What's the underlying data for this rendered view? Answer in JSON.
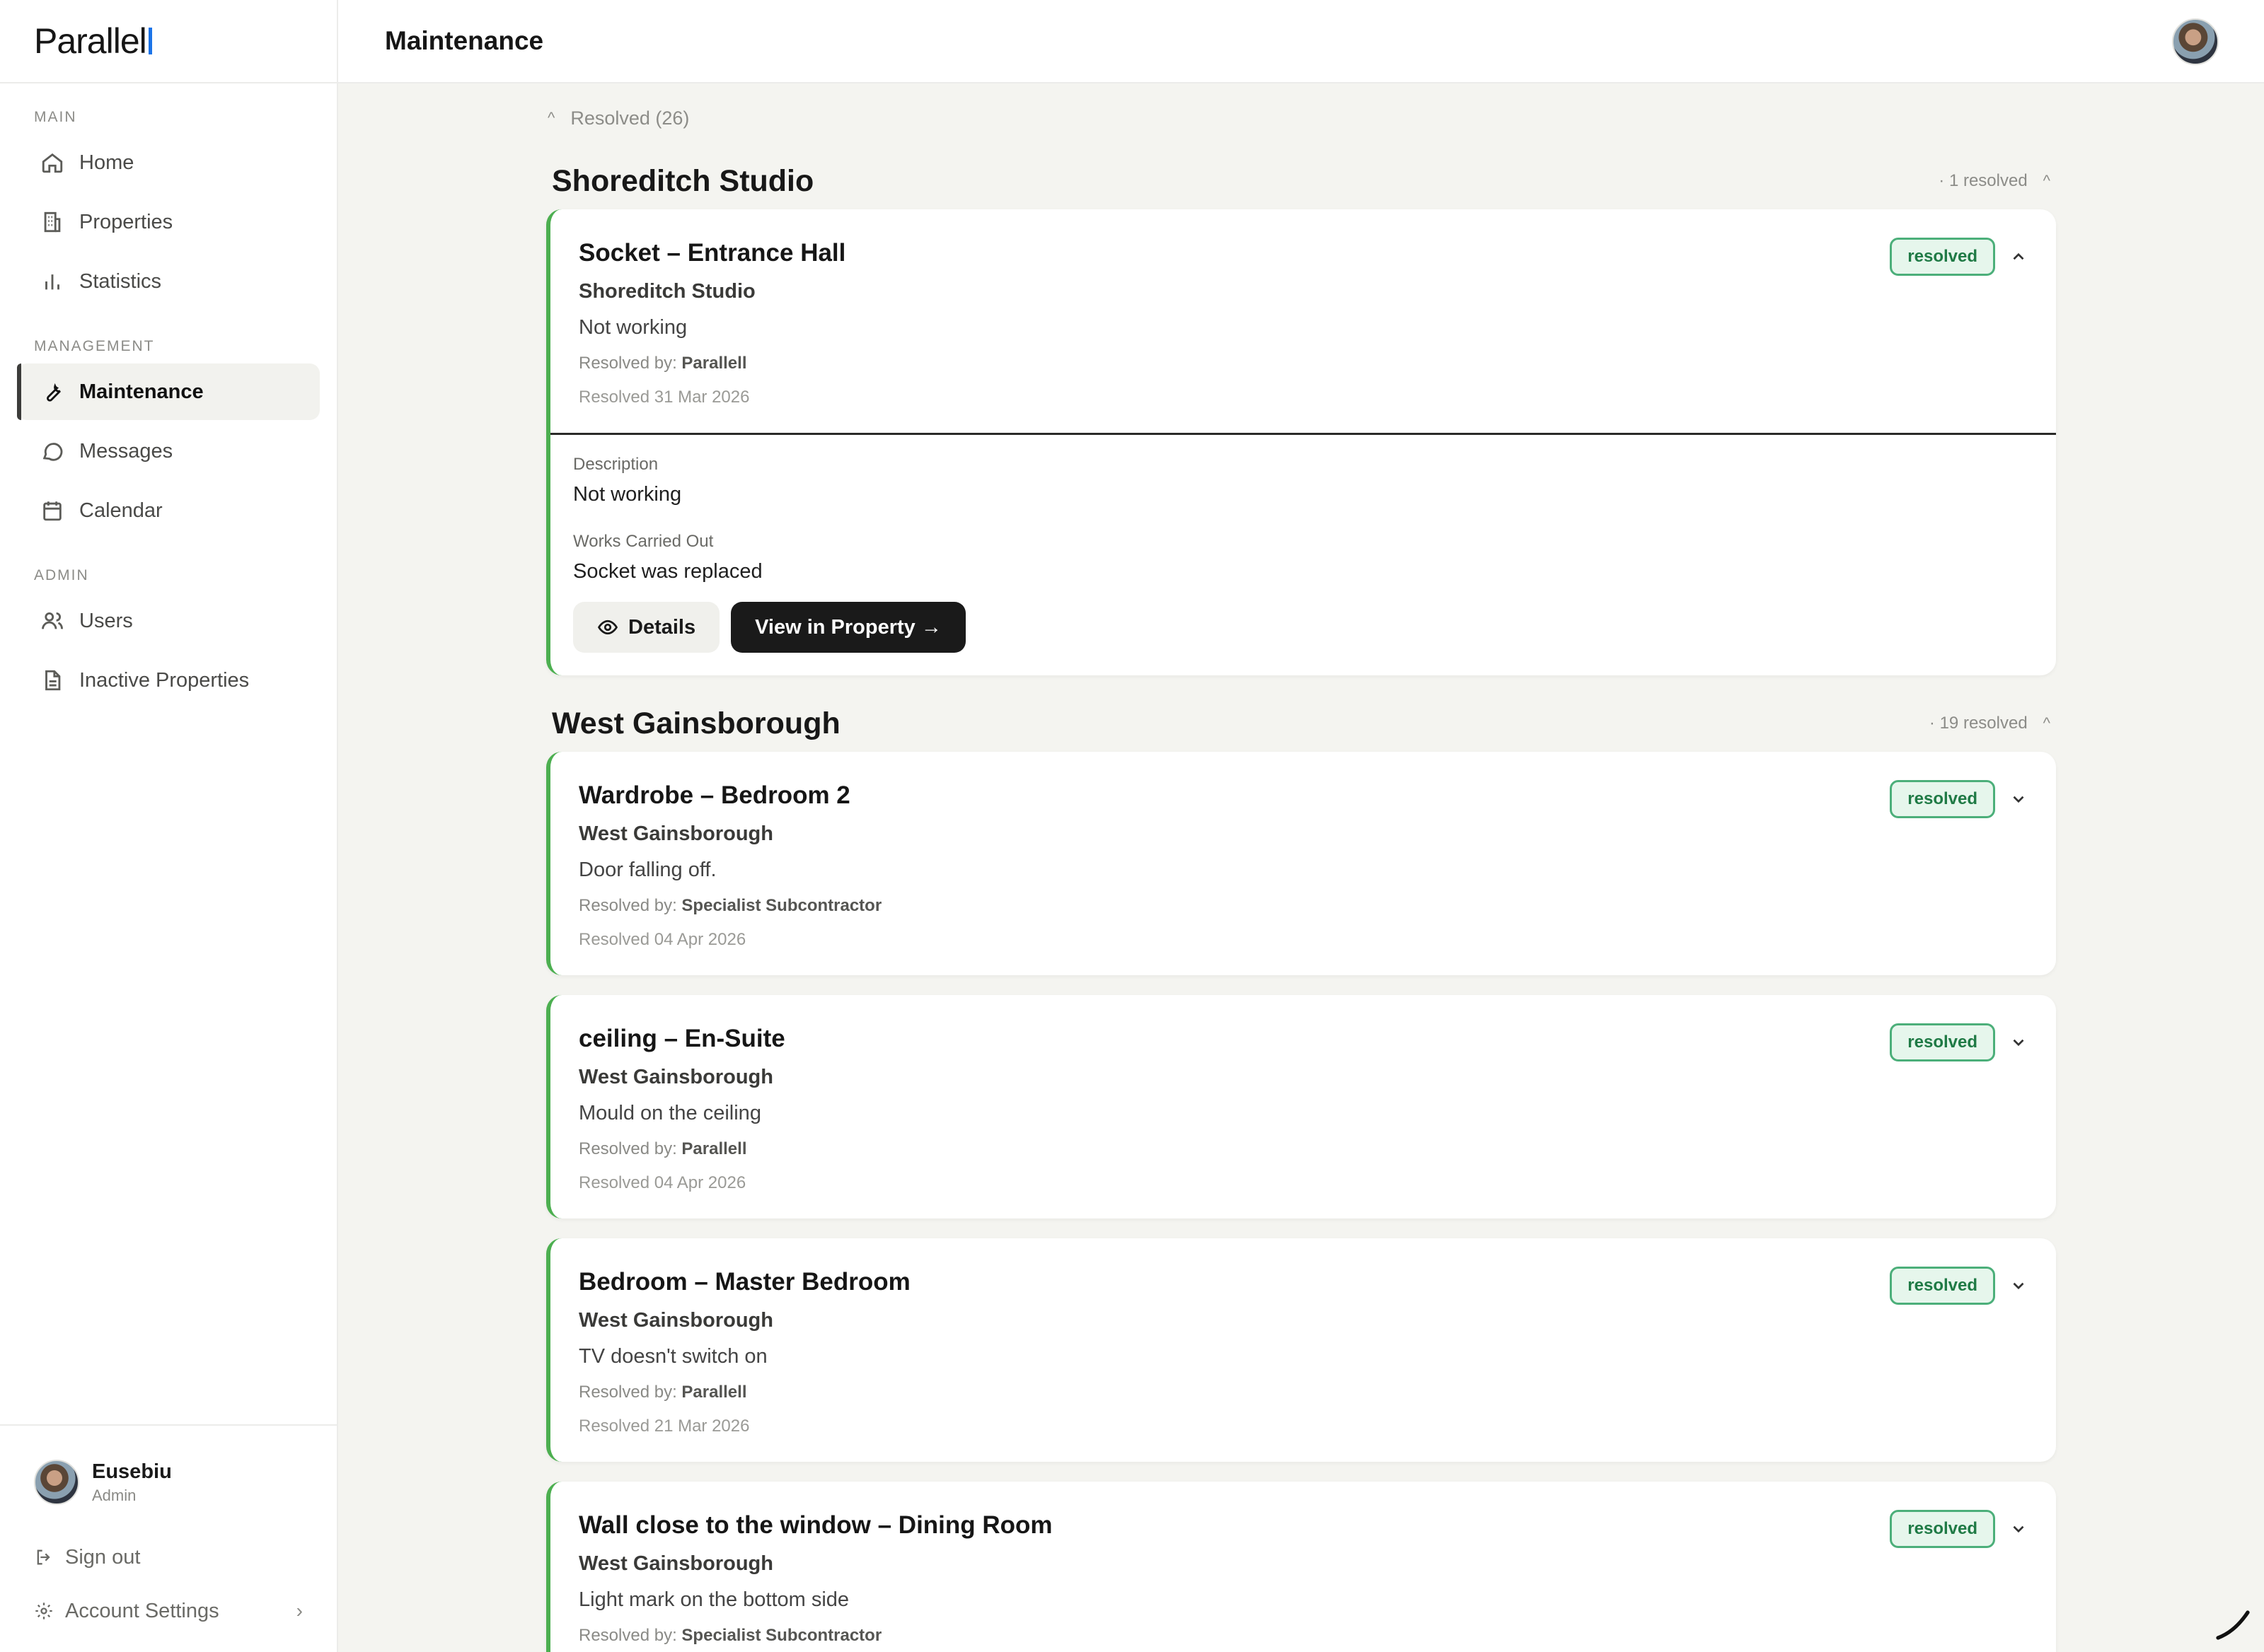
{
  "app": {
    "logo_text": "Parallel",
    "logo_tail": "l"
  },
  "header": {
    "title": "Maintenance"
  },
  "sidebar": {
    "sections": [
      {
        "heading": "MAIN",
        "items": [
          {
            "label": "Home",
            "icon": "home-icon"
          },
          {
            "label": "Properties",
            "icon": "building-icon"
          },
          {
            "label": "Statistics",
            "icon": "bar-chart-icon"
          }
        ]
      },
      {
        "heading": "MANAGEMENT",
        "items": [
          {
            "label": "Maintenance",
            "icon": "wrench-icon",
            "active": true
          },
          {
            "label": "Messages",
            "icon": "message-icon"
          },
          {
            "label": "Calendar",
            "icon": "calendar-icon"
          }
        ]
      },
      {
        "heading": "ADMIN",
        "items": [
          {
            "label": "Users",
            "icon": "users-icon"
          },
          {
            "label": "Inactive Properties",
            "icon": "document-icon"
          }
        ]
      }
    ],
    "user": {
      "name": "Eusebiu",
      "role": "Admin"
    },
    "sign_out": "Sign out",
    "account_settings": "Account Settings"
  },
  "main": {
    "resolved_toggle": "Resolved (26)",
    "groups": [
      {
        "title": "Shoreditch Studio",
        "count": "· 1 resolved",
        "cards": [
          {
            "title": "Socket – Entrance Hall",
            "property": "Shoreditch Studio",
            "description": "Not working",
            "resolved_by_label": "Resolved by:",
            "resolved_by": "Parallell",
            "date": "Resolved 31 Mar 2026",
            "status": "resolved",
            "expanded": true,
            "details": {
              "description_label": "Description",
              "description": "Not working",
              "works_label": "Works Carried Out",
              "works": "Socket was replaced",
              "details_button": "Details",
              "view_button": "View in Property →"
            }
          }
        ]
      },
      {
        "title": "West Gainsborough",
        "count": "· 19 resolved",
        "cards": [
          {
            "title": "Wardrobe – Bedroom 2",
            "property": "West Gainsborough",
            "description": "Door falling off.",
            "resolved_by_label": "Resolved by:",
            "resolved_by": "Specialist Subcontractor",
            "date": "Resolved 04 Apr 2026",
            "status": "resolved"
          },
          {
            "title": "ceiling – En-Suite",
            "property": "West Gainsborough",
            "description": "Mould on the ceiling",
            "resolved_by_label": "Resolved by:",
            "resolved_by": "Parallell",
            "date": "Resolved 04 Apr 2026",
            "status": "resolved"
          },
          {
            "title": "Bedroom – Master Bedroom",
            "property": "West Gainsborough",
            "description": "TV doesn't switch on",
            "resolved_by_label": "Resolved by:",
            "resolved_by": "Parallell",
            "date": "Resolved 21 Mar 2026",
            "status": "resolved"
          },
          {
            "title": "Wall close to the window – Dining Room",
            "property": "West Gainsborough",
            "description": "Light mark on the bottom side",
            "resolved_by_label": "Resolved by:",
            "resolved_by": "Specialist Subcontractor",
            "date": "",
            "status": "resolved"
          }
        ]
      }
    ]
  },
  "colors": {
    "accent_green": "#4caf50",
    "badge_bg": "#e6f6ec",
    "badge_text": "#1f7a45",
    "dark_button": "#1a1a1a"
  }
}
